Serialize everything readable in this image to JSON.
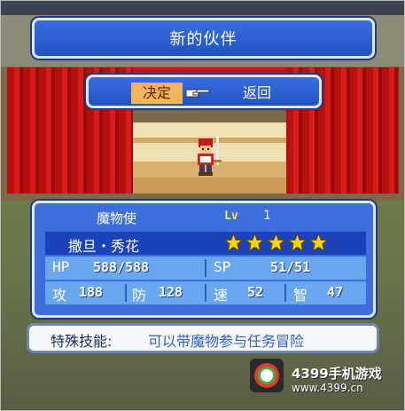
{
  "header": {
    "title": "新的伙伴"
  },
  "choice": {
    "decide_label": "决定",
    "back_label": "返回"
  },
  "character": {
    "job": "魔物使",
    "level_label": "Lv",
    "level": "1",
    "name": "撒旦・秀花",
    "stars": 5
  },
  "stats": {
    "hp_label": "HP",
    "hp_value": "588/588",
    "sp_label": "SP",
    "sp_value": "51/51",
    "atk_label": "攻",
    "atk_value": "188",
    "def_label": "防",
    "def_value": "128",
    "spd_label": "速",
    "spd_value": "52",
    "int_label": "智",
    "int_value": "47"
  },
  "skill": {
    "label": "特殊技能:",
    "text": "可以带魔物参与任务冒险"
  },
  "watermark": {
    "brand": "4399手机游戏",
    "url": "www.4399.cn",
    "logo_text": "4399"
  },
  "colors": {
    "panel_blue": "#3c6ede",
    "accent_orange": "#f3b45c",
    "star_yellow": "#ffd800",
    "curtain_red": "#c81414"
  }
}
